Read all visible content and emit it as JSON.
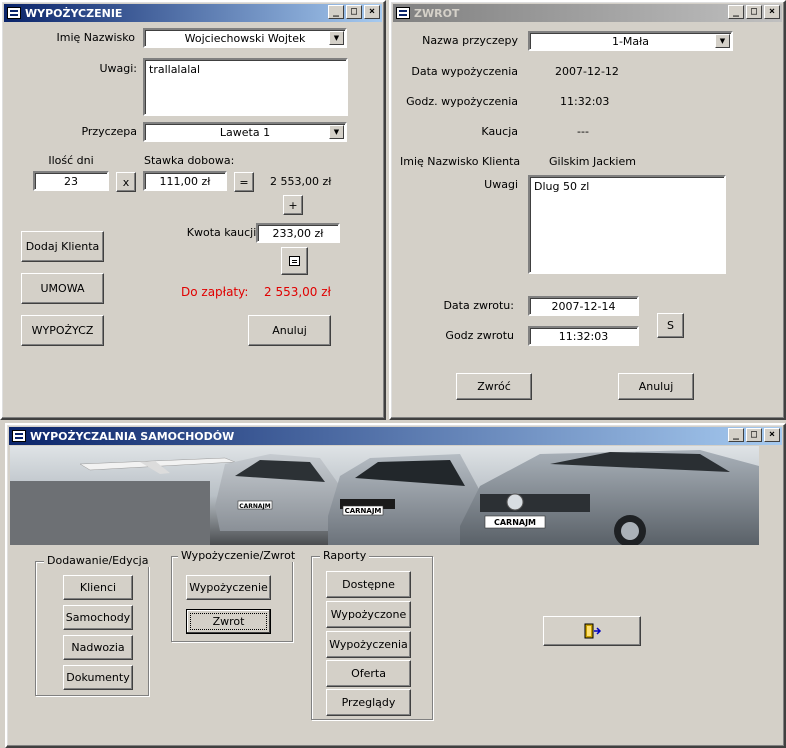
{
  "wypozyczenie": {
    "title": "WYPOŻYCZENIE",
    "imie_label": "Imię Nazwisko",
    "imie_value": "Wojciechowski Wojtek",
    "uwagi_label": "Uwagi:",
    "uwagi_value": "trallalalal",
    "przyczepa_label": "Przyczepa",
    "przyczepa_value": "Laweta 1",
    "ilosc_dni_label": "Ilość dni",
    "ilosc_dni_value": "23",
    "x_button": "x",
    "stawka_label": "Stawka dobowa:",
    "stawka_value": "111,00 zł",
    "eq_button": "=",
    "suma_value": "2 553,00 zł",
    "plus_button": "+",
    "kaucja_label": "Kwota kaucji:",
    "kaucja_value": "233,00 zł",
    "do_zaplaty_label": "Do zapłaty:",
    "do_zaplaty_value": "2 553,00 zł",
    "dodaj_klienta_button": "Dodaj Klienta",
    "umowa_button": "UMOWA",
    "wypozycz_button": "WYPOŻYCZ",
    "anuluj_button": "Anuluj"
  },
  "zwrot": {
    "title": "ZWROT",
    "nazwa_przyczepy_label": "Nazwa przyczepy",
    "nazwa_przyczepy_value": "1-Mała",
    "data_wypozyczenia_label": "Data wypożyczenia",
    "data_wypozyczenia_value": "2007-12-12",
    "godz_wypozyczenia_label": "Godz. wypożyczenia",
    "godz_wypozyczenia_value": "11:32:03",
    "kaucja_label": "Kaucja",
    "kaucja_value": "---",
    "klient_label": "Imię Nazwisko Klienta",
    "klient_value": "Gilskim Jackiem",
    "uwagi_label": "Uwagi",
    "uwagi_value": "Dlug 50 zl",
    "data_zwrotu_label": "Data zwrotu:",
    "data_zwrotu_value": "2007-12-14",
    "godz_zwrotu_label": "Godz zwrotu",
    "godz_zwrotu_value": "11:32:03",
    "s_button": "S",
    "zwroc_button": "Zwróć",
    "anuluj_button": "Anuluj"
  },
  "main": {
    "title": "WYPOŻYCZALNIA SAMOCHODÓW",
    "banner_plates": [
      "CARNAJM",
      "CARNAJM",
      "CARNAJM"
    ],
    "group1": {
      "title": "Dodawanie/Edycja",
      "buttons": [
        "Klienci",
        "Samochody",
        "Nadwozia",
        "Dokumenty"
      ]
    },
    "group2": {
      "title": "Wypożyczenie/Zwrot",
      "buttons": [
        "Wypożyczenie",
        "Zwrot"
      ]
    },
    "group3": {
      "title": "Raporty",
      "buttons": [
        "Dostępne",
        "Wypożyczone",
        "Wypożyczenia",
        "Oferta",
        "Przeglądy"
      ]
    },
    "exit_icon": "exit-door-icon"
  },
  "window_controls": {
    "minimize": "_",
    "maximize": "□",
    "close": "×"
  }
}
